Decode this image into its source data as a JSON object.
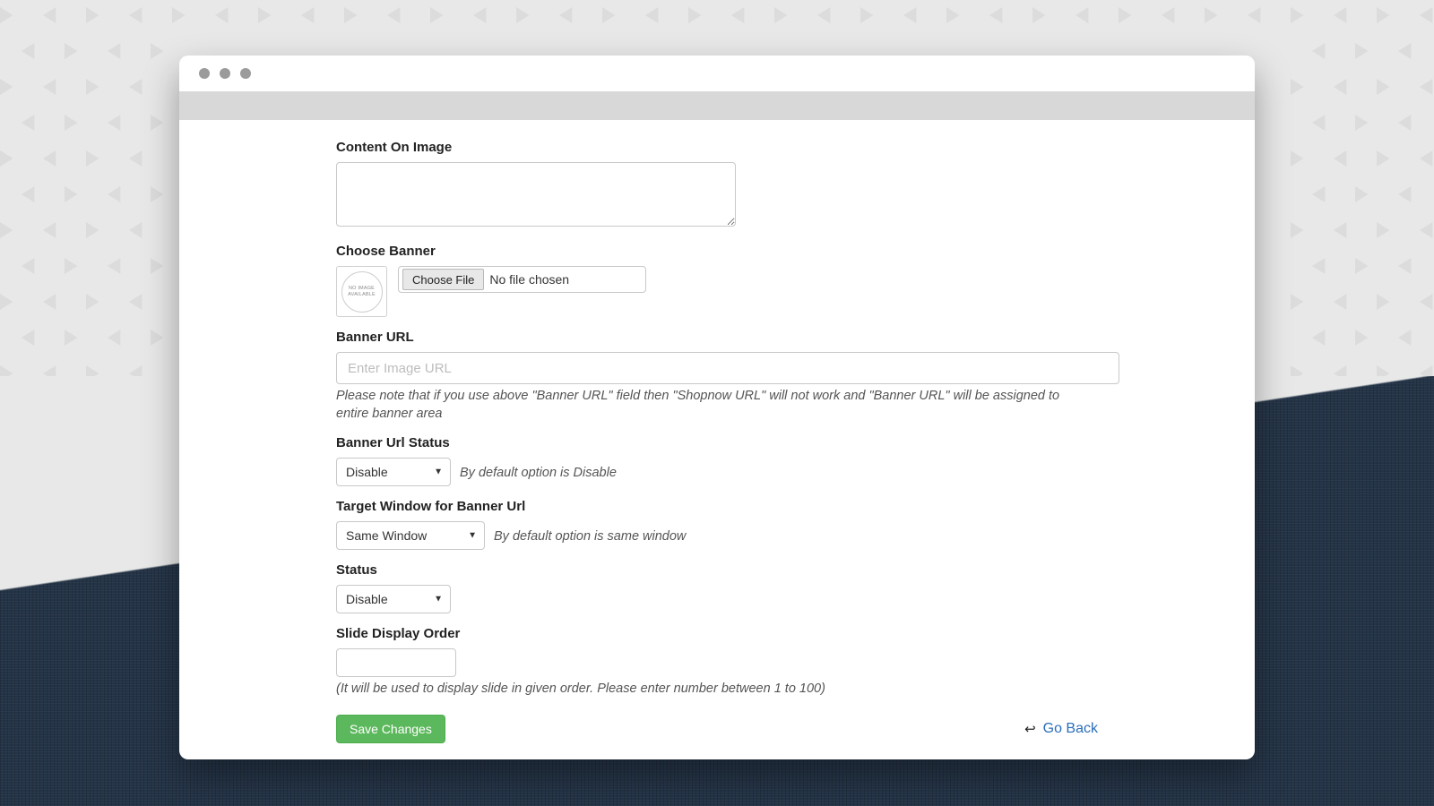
{
  "form": {
    "content_on_image": {
      "label": "Content On Image",
      "value": ""
    },
    "choose_banner": {
      "label": "Choose Banner",
      "thumb_text": "NO IMAGE AVAILABLE",
      "button": "Choose File",
      "status": "No file chosen"
    },
    "banner_url": {
      "label": "Banner URL",
      "placeholder": "Enter Image URL",
      "value": "",
      "hint": "Please note that if you use above \"Banner URL\" field then \"Shopnow URL\" will not work and \"Banner URL\" will be assigned to entire banner area"
    },
    "banner_url_status": {
      "label": "Banner Url Status",
      "value": "Disable",
      "hint": "By default option is Disable"
    },
    "target_window": {
      "label": "Target Window for Banner Url",
      "value": "Same Window",
      "hint": "By default option is same window"
    },
    "status": {
      "label": "Status",
      "value": "Disable"
    },
    "slide_order": {
      "label": "Slide Display Order",
      "value": "",
      "hint": "(It will be used to display slide in given order. Please enter number between 1 to 100)"
    },
    "save": "Save Changes",
    "goback": "Go Back"
  }
}
